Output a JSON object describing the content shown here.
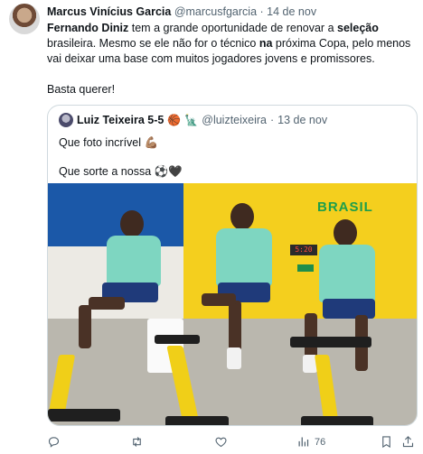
{
  "tweet": {
    "author": {
      "name": "Marcus Vinícius Garcia",
      "handle": "@marcusfgarcia",
      "separator": "·",
      "date": "14 de nov"
    },
    "text": {
      "l1_a": "Fernando Diniz",
      "l1_b": " tem a grande oportunidade  de renovar a ",
      "l1_c": "seleção",
      "l2_a": "brasileira. Mesmo se ele não for o técnico ",
      "l2_b": "na",
      "l2_c": " próxima Copa, pelo menos",
      "l3": "vai deixar uma base com muitos jogadores jovens e promissores.",
      "l4": "Basta querer!"
    }
  },
  "quote": {
    "author": {
      "name": "Luiz Teixeira 5-5",
      "emoji1": "🏀",
      "emoji2": "🗽",
      "handle": "@luizteixeira",
      "separator": "·",
      "date": "13 de nov"
    },
    "text1": "Que foto incrível 💪🏽",
    "text2": "Que sorte a nossa ⚽🖤",
    "photo": {
      "wall_text": "BRASIL",
      "clock": "5:20"
    }
  },
  "actions": {
    "views": "76"
  },
  "icons": [
    "reply-icon",
    "retweet-icon",
    "like-icon",
    "views-icon",
    "bookmark-icon",
    "share-icon"
  ],
  "colors": {
    "text": "#0f1419",
    "muted": "#536471",
    "border": "#cfd9de",
    "brazil_yellow": "#f4cf1e",
    "brazil_green": "#1d9e4b"
  }
}
